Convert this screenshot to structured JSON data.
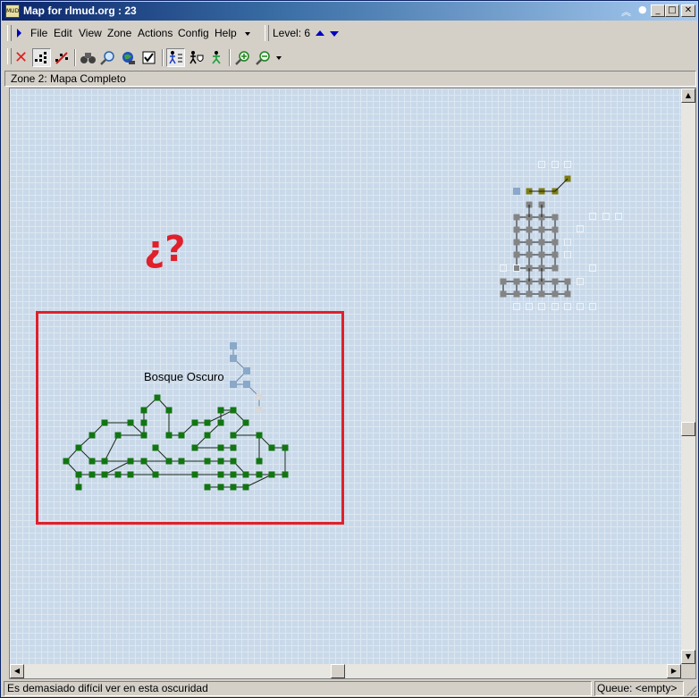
{
  "window": {
    "title": "Map for rlmud.org : 23",
    "icon_text": "MUD"
  },
  "menu": {
    "items": [
      "File",
      "Edit",
      "View",
      "Zone",
      "Actions",
      "Config",
      "Help"
    ],
    "level_label": "Level: 6"
  },
  "toolbar": {
    "icons": [
      "delete-icon",
      "room-grid-icon",
      "route-icon",
      "binoculars-icon",
      "find-icon",
      "globe-icon",
      "checkbox-icon",
      "walker-list-icon",
      "walker-shield-icon",
      "walker-icon",
      "zoom-in-icon",
      "zoom-out-icon"
    ]
  },
  "zone": {
    "label": "Zone 2: Mapa Completo"
  },
  "map": {
    "area_label": "Bosque Oscuro",
    "annotation": "¿?",
    "colors": {
      "highlight_box": "#e0202a",
      "forest_room": "#127512",
      "light_room": "#8aa8c8",
      "gray_room": "#848484",
      "olive_room": "#7d7d10"
    }
  },
  "status": {
    "message": "Es demasiado difícil ver en esta oscuridad",
    "queue": "Queue: <empty>"
  }
}
